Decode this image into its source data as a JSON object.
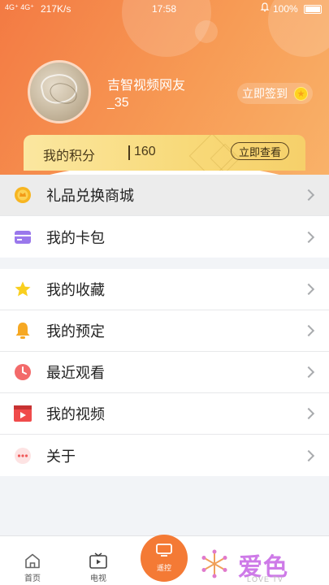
{
  "status_bar": {
    "signal": "4G⁺ 4G⁺",
    "speed": "217K/s",
    "time": "17:58",
    "battery": "100%"
  },
  "profile": {
    "username": "吉智视频网友_35",
    "checkin_label": "立即签到",
    "points_label": "我的积分",
    "points_value": "160",
    "points_button": "立即查看"
  },
  "menu_group_1": [
    {
      "label": "礼品兑换商城",
      "icon": "gift-coin-icon"
    },
    {
      "label": "我的卡包",
      "icon": "card-icon"
    }
  ],
  "menu_group_2": [
    {
      "label": "我的收藏",
      "icon": "star-icon"
    },
    {
      "label": "我的预定",
      "icon": "bell-icon"
    },
    {
      "label": "最近观看",
      "icon": "clock-icon"
    },
    {
      "label": "我的视频",
      "icon": "video-icon"
    },
    {
      "label": "关于",
      "icon": "more-icon"
    }
  ],
  "tabbar": {
    "home": "首页",
    "tv": "电视",
    "remote": "遥控"
  },
  "watermark": {
    "text": "爱色",
    "sub": "LOVE TV"
  },
  "colors": {
    "accent": "#f47a35",
    "gold": "#f8d978"
  }
}
